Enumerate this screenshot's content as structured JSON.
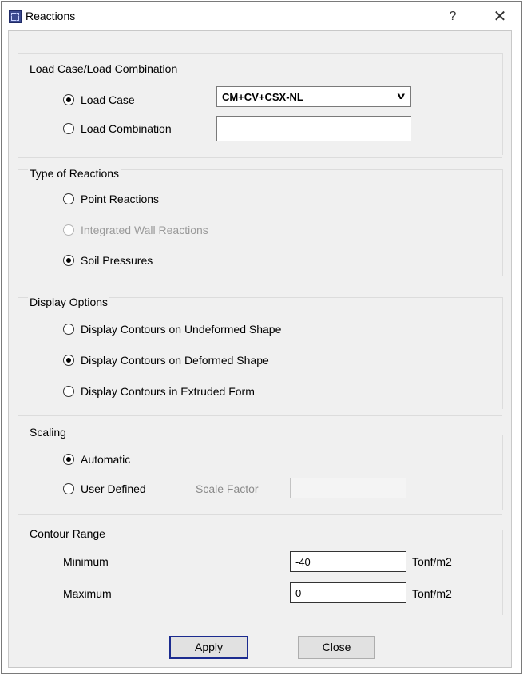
{
  "window": {
    "title": "Reactions",
    "help": "?",
    "close": "✕"
  },
  "load": {
    "group_label": "Load Case/Load Combination",
    "load_case_label": "Load Case",
    "load_case_value": "CM+CV+CSX-NL",
    "load_combo_label": "Load Combination"
  },
  "reactions": {
    "group_label": "Type of Reactions",
    "point": "Point Reactions",
    "integrated": "Integrated Wall Reactions",
    "soil": "Soil Pressures"
  },
  "display": {
    "group_label": "Display Options",
    "undeformed": "Display Contours on Undeformed Shape",
    "deformed": "Display Contours on Deformed Shape",
    "extruded": "Display Contours in Extruded Form"
  },
  "scaling": {
    "group_label": "Scaling",
    "automatic": "Automatic",
    "user_defined": "User Defined",
    "scale_factor_label": "Scale Factor"
  },
  "contour": {
    "group_label": "Contour Range",
    "min_label": "Minimum",
    "min_value": "-40",
    "max_label": "Maximum",
    "max_value": "0",
    "unit": "Tonf/m2"
  },
  "buttons": {
    "apply": "Apply",
    "close": "Close"
  }
}
